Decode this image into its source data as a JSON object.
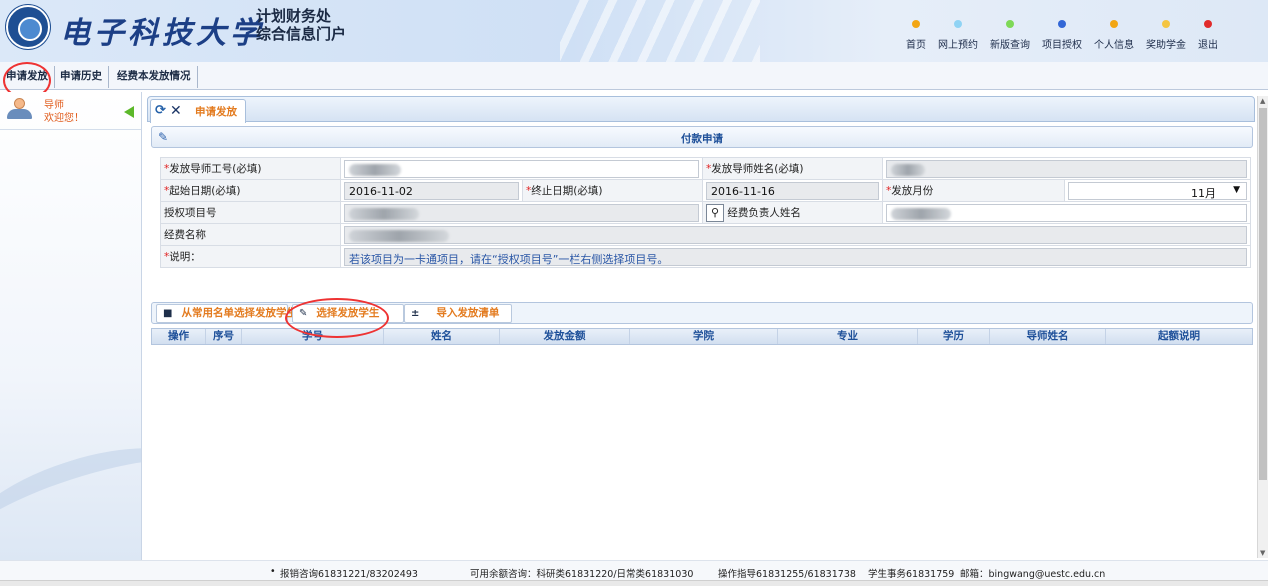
{
  "header": {
    "logo_text": "电子科技大学",
    "portal_title_line1": "计划财务处",
    "portal_title_line2": "综合信息门户",
    "nav": [
      {
        "label": "首页",
        "color": "#f2a614"
      },
      {
        "label": "网上预约",
        "color": "#8fd3f4"
      },
      {
        "label": "新版查询",
        "color": "#7ed957"
      },
      {
        "label": "项目授权",
        "color": "#3367d6"
      },
      {
        "label": "个人信息",
        "color": "#f2a614"
      },
      {
        "label": "奖助学金",
        "color": "#f4c542"
      },
      {
        "label": "退出",
        "color": "#e12b2b"
      }
    ]
  },
  "menu": {
    "tabs": [
      "申请发放",
      "申请历史",
      "经费本发放情况"
    ]
  },
  "sidebar": {
    "role": "导师",
    "welcome": "欢迎您！"
  },
  "content": {
    "tab_label": "申请发放",
    "panel_title": "付款申请",
    "form": {
      "teacher_id_label": "发放导师工号(必填)",
      "teacher_name_label": "发放导师姓名(必填)",
      "start_date_label": "起始日期(必填)",
      "start_date_value": "2016-11-02",
      "end_date_label": "终止日期(必填)",
      "end_date_value": "2016-11-16",
      "month_label": "发放月份",
      "month_value": "11月",
      "project_no_label": "授权项目号",
      "manager_label": "经费负责人姓名",
      "fund_name_label": "经费名称",
      "note_label": "说明：",
      "note_value": "若该项目为一卡通项目，请在“授权项目号”一栏右侧选择项目号。"
    },
    "toolbar": {
      "from_list": "从常用名单选择发放学生",
      "select_students": "选择发放学生",
      "import_list": "导入发放清单"
    },
    "grid_columns": [
      "操作",
      "序号",
      "学号",
      "姓名",
      "发放金额",
      "学院",
      "专业",
      "学历",
      "导师姓名",
      "起额说明"
    ]
  },
  "footer": {
    "text1": "报销咨询61831221/83202493",
    "text2": "可用余额咨询：科研类61831220/日常类61831030",
    "text3": "操作指导61831255/61831738",
    "text4": "学生事务61831759",
    "text5": "邮箱：bingwang@uestc.edu.cn"
  }
}
